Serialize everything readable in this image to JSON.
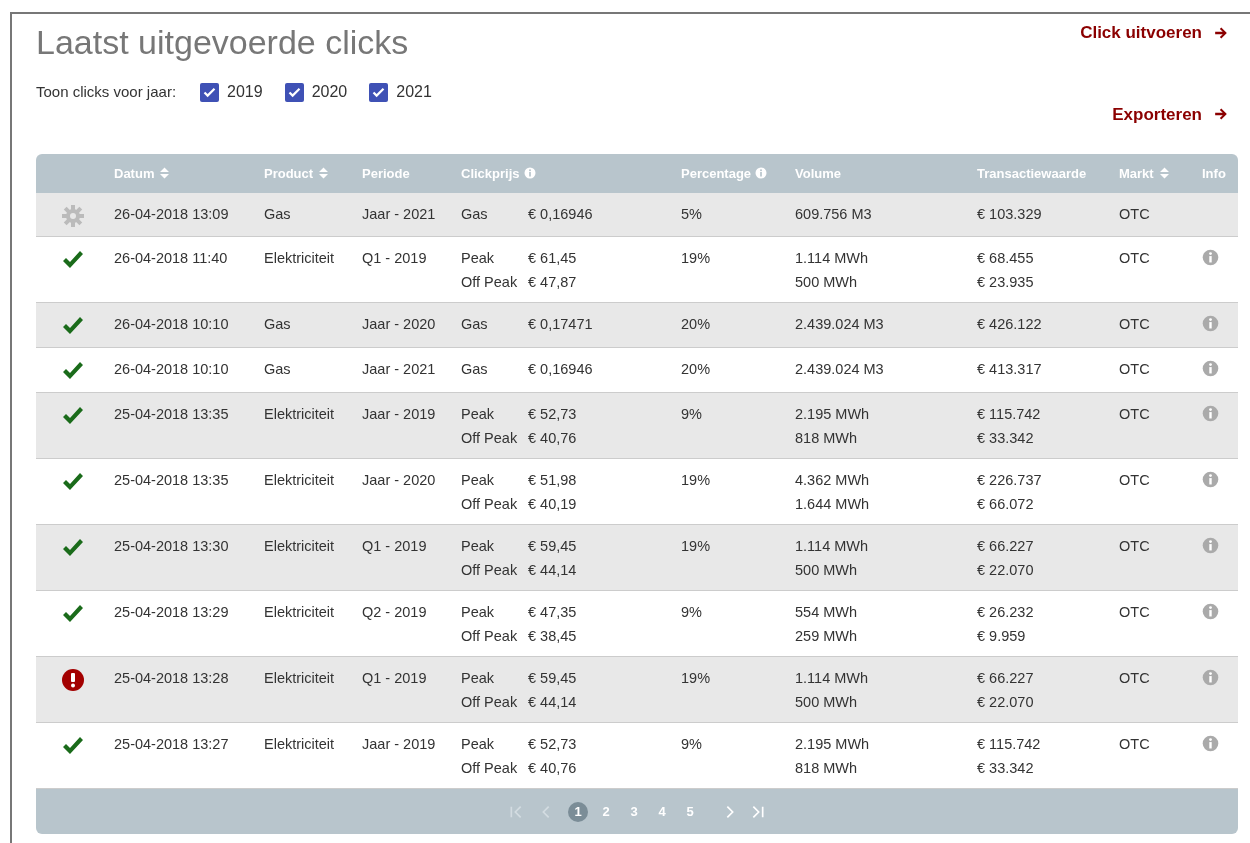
{
  "title": "Laatst uitgevoerde clicks",
  "actions": [
    {
      "label": "Click uitvoeren"
    },
    {
      "label": "Exporteren"
    }
  ],
  "year_filter": {
    "label": "Toon clicks voor jaar:",
    "years": [
      {
        "label": "2019",
        "checked": true
      },
      {
        "label": "2020",
        "checked": true
      },
      {
        "label": "2021",
        "checked": true
      }
    ]
  },
  "table": {
    "columns": [
      {
        "label": "Datum",
        "kind": "sortable"
      },
      {
        "label": "Product",
        "kind": "sortable"
      },
      {
        "label": "Periode",
        "kind": "plain"
      },
      {
        "label": "Clickprijs",
        "kind": "info"
      },
      {
        "label": "Percentage",
        "kind": "info"
      },
      {
        "label": "Volume",
        "kind": "plain"
      },
      {
        "label": "Transactiewaarde",
        "kind": "plain"
      },
      {
        "label": "Markt",
        "kind": "sortable"
      },
      {
        "label": "Info",
        "kind": "plain"
      }
    ],
    "rows": [
      {
        "kind": "pending",
        "datum": "26-04-2018 13:09",
        "product": "Gas",
        "periode": "Jaar - 2021",
        "prices": [
          {
            "label": "Gas",
            "price": "€ 0,16946"
          }
        ],
        "percentage": "5%",
        "volumes": [
          "609.756 M3"
        ],
        "values": [
          "€ 103.329"
        ],
        "markt": "OTC",
        "has_info": false
      },
      {
        "kind": "done",
        "datum": "26-04-2018 11:40",
        "product": "Elektriciteit",
        "periode": "Q1 - 2019",
        "prices": [
          {
            "label": "Peak",
            "price": "€ 61,45"
          },
          {
            "label": "Off Peak",
            "price": "€ 47,87"
          }
        ],
        "percentage": "19%",
        "volumes": [
          "1.114 MWh",
          "500 MWh"
        ],
        "values": [
          "€ 68.455",
          "€ 23.935"
        ],
        "markt": "OTC",
        "has_info": true
      },
      {
        "kind": "done",
        "datum": "26-04-2018 10:10",
        "product": "Gas",
        "periode": "Jaar - 2020",
        "prices": [
          {
            "label": "Gas",
            "price": "€ 0,17471"
          }
        ],
        "percentage": "20%",
        "volumes": [
          "2.439.024 M3"
        ],
        "values": [
          "€ 426.122"
        ],
        "markt": "OTC",
        "has_info": true
      },
      {
        "kind": "done",
        "datum": "26-04-2018 10:10",
        "product": "Gas",
        "periode": "Jaar - 2021",
        "prices": [
          {
            "label": "Gas",
            "price": "€ 0,16946"
          }
        ],
        "percentage": "20%",
        "volumes": [
          "2.439.024 M3"
        ],
        "values": [
          "€ 413.317"
        ],
        "markt": "OTC",
        "has_info": true
      },
      {
        "kind": "done",
        "datum": "25-04-2018 13:35",
        "product": "Elektriciteit",
        "periode": "Jaar - 2019",
        "prices": [
          {
            "label": "Peak",
            "price": "€ 52,73"
          },
          {
            "label": "Off Peak",
            "price": "€ 40,76"
          }
        ],
        "percentage": "9%",
        "volumes": [
          "2.195 MWh",
          "818 MWh"
        ],
        "values": [
          "€ 115.742",
          "€ 33.342"
        ],
        "markt": "OTC",
        "has_info": true
      },
      {
        "kind": "done",
        "datum": "25-04-2018 13:35",
        "product": "Elektriciteit",
        "periode": "Jaar - 2020",
        "prices": [
          {
            "label": "Peak",
            "price": "€ 51,98"
          },
          {
            "label": "Off Peak",
            "price": "€ 40,19"
          }
        ],
        "percentage": "19%",
        "volumes": [
          "4.362 MWh",
          "1.644 MWh"
        ],
        "values": [
          "€ 226.737",
          "€ 66.072"
        ],
        "markt": "OTC",
        "has_info": true
      },
      {
        "kind": "done",
        "datum": "25-04-2018 13:30",
        "product": "Elektriciteit",
        "periode": "Q1 - 2019",
        "prices": [
          {
            "label": "Peak",
            "price": "€ 59,45"
          },
          {
            "label": "Off Peak",
            "price": "€ 44,14"
          }
        ],
        "percentage": "19%",
        "volumes": [
          "1.114 MWh",
          "500 MWh"
        ],
        "values": [
          "€ 66.227",
          "€ 22.070"
        ],
        "markt": "OTC",
        "has_info": true
      },
      {
        "kind": "done",
        "datum": "25-04-2018 13:29",
        "product": "Elektriciteit",
        "periode": "Q2 - 2019",
        "prices": [
          {
            "label": "Peak",
            "price": "€ 47,35"
          },
          {
            "label": "Off Peak",
            "price": "€ 38,45"
          }
        ],
        "percentage": "9%",
        "volumes": [
          "554 MWh",
          "259 MWh"
        ],
        "values": [
          "€ 26.232",
          "€ 9.959"
        ],
        "markt": "OTC",
        "has_info": true
      },
      {
        "kind": "error",
        "datum": "25-04-2018 13:28",
        "product": "Elektriciteit",
        "periode": "Q1 - 2019",
        "prices": [
          {
            "label": "Peak",
            "price": "€ 59,45"
          },
          {
            "label": "Off Peak",
            "price": "€ 44,14"
          }
        ],
        "percentage": "19%",
        "volumes": [
          "1.114 MWh",
          "500 MWh"
        ],
        "values": [
          "€ 66.227",
          "€ 22.070"
        ],
        "markt": "OTC",
        "has_info": true
      },
      {
        "kind": "done",
        "datum": "25-04-2018 13:27",
        "product": "Elektriciteit",
        "periode": "Jaar - 2019",
        "prices": [
          {
            "label": "Peak",
            "price": "€ 52,73"
          },
          {
            "label": "Off Peak",
            "price": "€ 40,76"
          }
        ],
        "percentage": "9%",
        "volumes": [
          "2.195 MWh",
          "818 MWh"
        ],
        "values": [
          "€ 115.742",
          "€ 33.342"
        ],
        "markt": "OTC",
        "has_info": true
      }
    ]
  },
  "pagination": {
    "first_disabled": true,
    "prev_disabled": true,
    "pages": [
      {
        "label": "1",
        "selected": true
      },
      {
        "label": "2",
        "selected": false
      },
      {
        "label": "3",
        "selected": false
      },
      {
        "label": "4",
        "selected": false
      },
      {
        "label": "5",
        "selected": false
      }
    ],
    "next_disabled": false,
    "last_disabled": false
  }
}
